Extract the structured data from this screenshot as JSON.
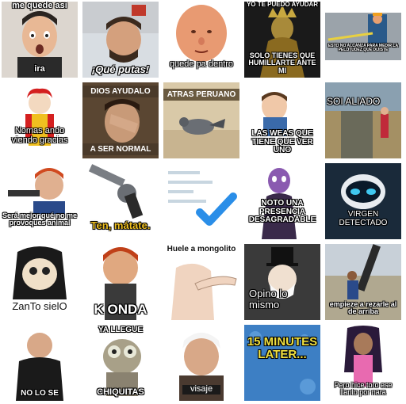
{
  "stickers": {
    "r1": {
      "c1": "me quede asi",
      "c1b": "ira",
      "c2": "¡Qué putas!",
      "c3": "quede pa dentro",
      "c4a": "YO TE PUEDO AYUDAR",
      "c4b": "SOLO TIENES QUE HUMILLARTE ANTE MI",
      "c5": "ESTO NO ALCANZA PARA MEDIR LA PELOTUDEZ QUE DIJISTE"
    },
    "r2": {
      "c1": "Nomas ando viendo gracias",
      "c2a": "DIOS AYUDALO",
      "c2b": "A SER NORMAL",
      "c3": "ATRAS PERUANO",
      "c4": "LAS WEAS QUE TIENE QUE VER UNO",
      "c5": "SOI ALIADO"
    },
    "r3": {
      "c1": "Será mejor qué no me provoques animal",
      "c2": "Ten, mátate.",
      "c4": "NOTO UNA PRESENCIA DESAGRADABLE",
      "c5": "VIRGEN DETECTADO"
    },
    "r4": {
      "c1": "ZanTo sielO",
      "c2": "K ONDA",
      "c3": "Huele a mongolito",
      "c4": "Opino lo mismo",
      "c5": "empieze a rezarle al de arriba"
    },
    "r5": {
      "c1": "NO LO SE",
      "c2a": "YA LLEGUE",
      "c2b": "CHIQUITAS",
      "c3": "visaje",
      "c4": "15 MINUTES LATER...",
      "c5": "Pero hice toro ese llanto por nara"
    }
  },
  "colors": {
    "background": "#ffffff",
    "checkmark": "#2a8ee8",
    "spongebob_blue": "#3d7fc4",
    "caption_white": "#ffffff"
  }
}
